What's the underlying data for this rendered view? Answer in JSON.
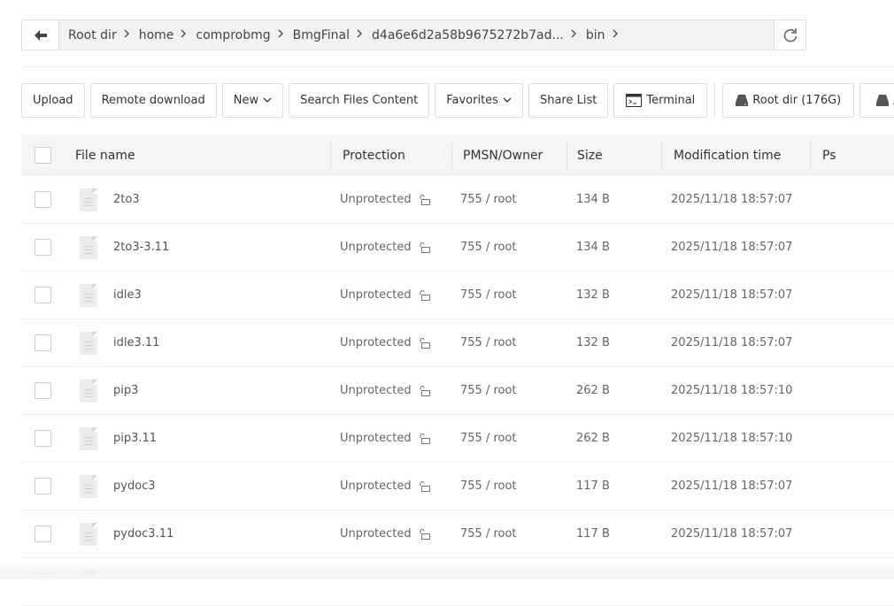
{
  "breadcrumb": {
    "items": [
      "Root dir",
      "home",
      "comprobmg",
      "BmgFinal",
      "d4a6e6d2a58b9675272b7ad...",
      "bin"
    ]
  },
  "toolbar": {
    "upload": "Upload",
    "remote_download": "Remote download",
    "new": "New",
    "search_content": "Search Files Content",
    "favorites": "Favorites",
    "share_list": "Share List",
    "terminal": "Terminal",
    "root_disk": "Root dir (176G)",
    "second_disk": "/"
  },
  "columns": {
    "name": "File name",
    "protection": "Protection",
    "owner": "PMSN/Owner",
    "size": "Size",
    "mtime": "Modification time",
    "ps": "Ps"
  },
  "files": [
    {
      "name": "2to3",
      "protection": "Unprotected",
      "owner": "755 / root",
      "size": "134 B",
      "mtime": "2025/11/18 18:57:07"
    },
    {
      "name": "2to3-3.11",
      "protection": "Unprotected",
      "owner": "755 / root",
      "size": "134 B",
      "mtime": "2025/11/18 18:57:07"
    },
    {
      "name": "idle3",
      "protection": "Unprotected",
      "owner": "755 / root",
      "size": "132 B",
      "mtime": "2025/11/18 18:57:07"
    },
    {
      "name": "idle3.11",
      "protection": "Unprotected",
      "owner": "755 / root",
      "size": "132 B",
      "mtime": "2025/11/18 18:57:07"
    },
    {
      "name": "pip3",
      "protection": "Unprotected",
      "owner": "755 / root",
      "size": "262 B",
      "mtime": "2025/11/18 18:57:10"
    },
    {
      "name": "pip3.11",
      "protection": "Unprotected",
      "owner": "755 / root",
      "size": "262 B",
      "mtime": "2025/11/18 18:57:10"
    },
    {
      "name": "pydoc3",
      "protection": "Unprotected",
      "owner": "755 / root",
      "size": "117 B",
      "mtime": "2025/11/18 18:57:07"
    },
    {
      "name": "pydoc3.11",
      "protection": "Unprotected",
      "owner": "755 / root",
      "size": "117 B",
      "mtime": "2025/11/18 18:57:07"
    }
  ]
}
